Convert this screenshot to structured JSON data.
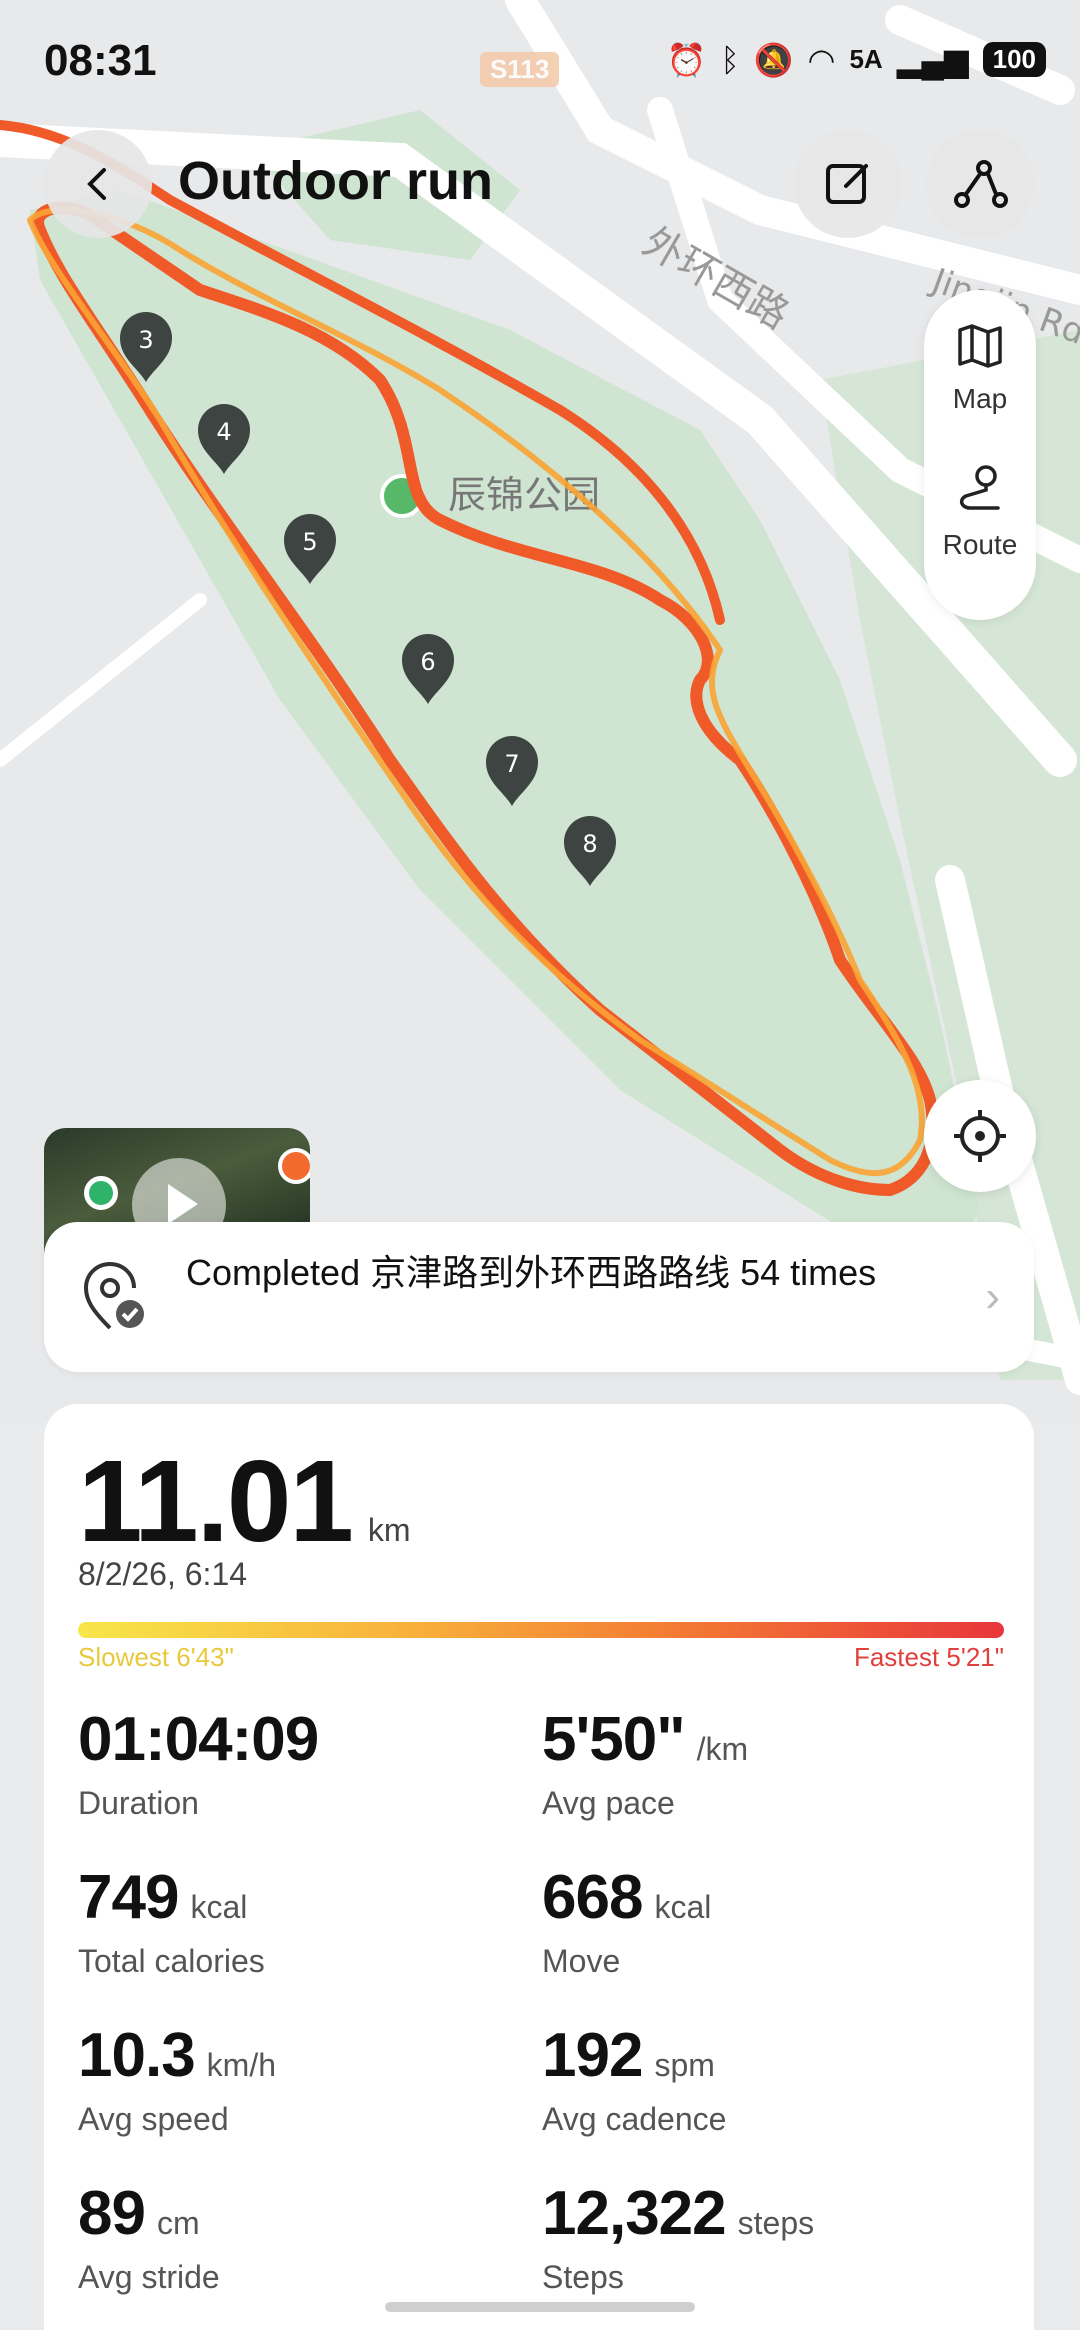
{
  "status_bar": {
    "time": "08:31",
    "network": "5A",
    "battery": "100"
  },
  "map": {
    "road_badge": "S113",
    "street_labels": [
      "外环西路",
      "Jingjin Rd",
      "辰锦公园"
    ],
    "km_markers": [
      "3",
      "4",
      "5",
      "6",
      "7",
      "8"
    ],
    "colors": {
      "route": "#f05a28",
      "route_highlight": "#f8a334",
      "park": "#cfe5d1",
      "road": "#ffffff",
      "ground": "#e8e9eb"
    }
  },
  "header": {
    "title": "Outdoor run"
  },
  "map_panel": {
    "map_label": "Map",
    "route_label": "Route"
  },
  "completed": {
    "text": "Completed 京津路到外环西路路线 54 times"
  },
  "summary": {
    "distance_value": "11.01",
    "distance_unit": "km",
    "date": "8/2/26, 6:14",
    "pace_range": {
      "slowest": "Slowest 6'43\"",
      "fastest": "Fastest 5'21\""
    }
  },
  "metrics": [
    {
      "value": "01:04:09",
      "unit": "",
      "label": "Duration"
    },
    {
      "value": "5'50\"",
      "unit": "/km",
      "label": "Avg pace"
    },
    {
      "value": "749",
      "unit": "kcal",
      "label": "Total calories"
    },
    {
      "value": "668",
      "unit": "kcal",
      "label": "Move"
    },
    {
      "value": "10.3",
      "unit": "km/h",
      "label": "Avg speed"
    },
    {
      "value": "192",
      "unit": "spm",
      "label": "Avg cadence"
    },
    {
      "value": "89",
      "unit": "cm",
      "label": "Avg stride"
    },
    {
      "value": "12,322",
      "unit": "steps",
      "label": "Steps"
    }
  ]
}
